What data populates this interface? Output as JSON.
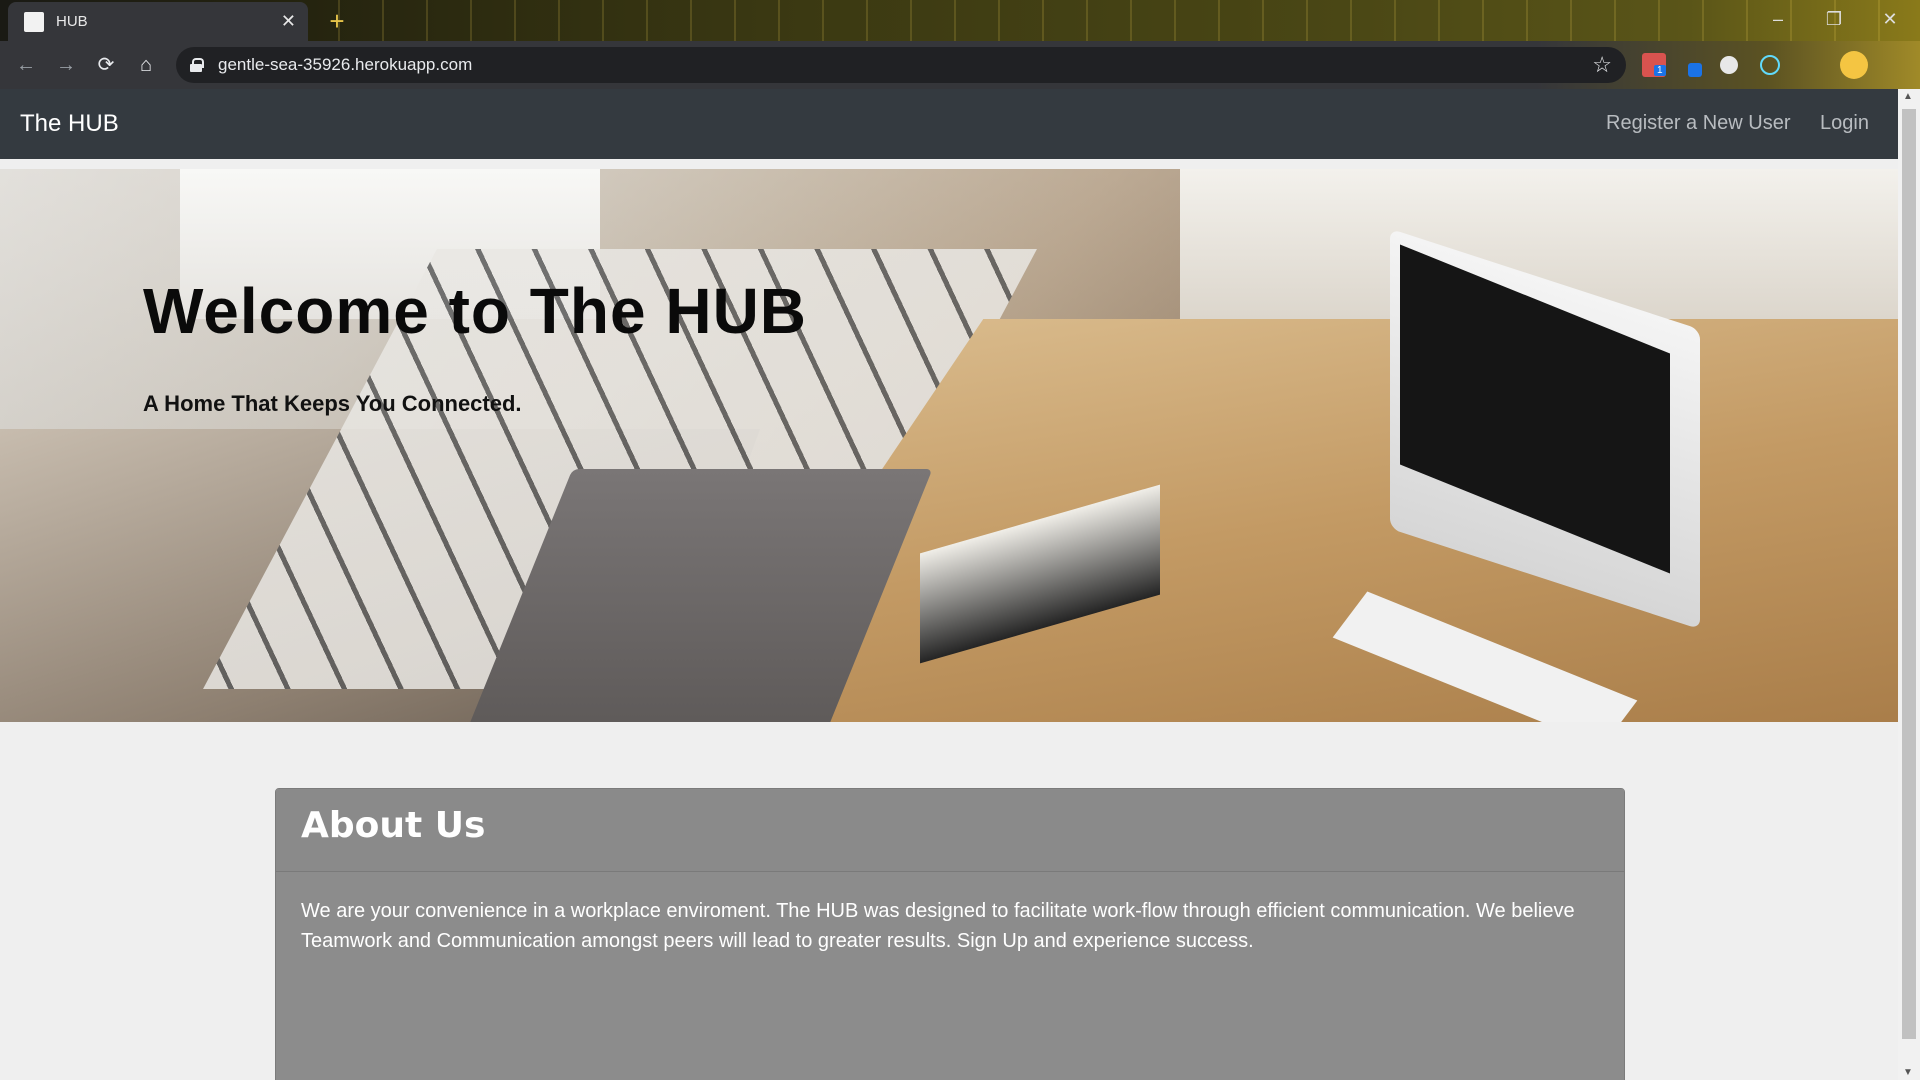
{
  "browser": {
    "tab_title": "HUB",
    "tab_close": "✕",
    "new_tab": "+",
    "url": "gentle-sea-35926.herokuapp.com",
    "window_controls": [
      "–",
      "❐",
      "✕"
    ],
    "nav": {
      "back": "←",
      "forward": "→",
      "reload": "⟳",
      "home": "⌂"
    },
    "bookmark_star": "☆",
    "extension_badge": "1",
    "accent_colors": {
      "frame": "#35363a",
      "omnibox": "#202124"
    }
  },
  "site": {
    "brand": "The HUB",
    "nav_links": {
      "register": "Register a New User",
      "login": "Login"
    },
    "navbar_color": "#343a40"
  },
  "hero": {
    "title": "Welcome to The HUB",
    "tagline": "A Home That Keeps You Connected."
  },
  "about": {
    "heading": "About Us",
    "body": "We are your convenience in a workplace enviroment. The HUB was designed to facilitate work-flow through efficient communication. We believe Teamwork and Communication amongst peers will lead to greater results. Sign Up and experience success."
  }
}
